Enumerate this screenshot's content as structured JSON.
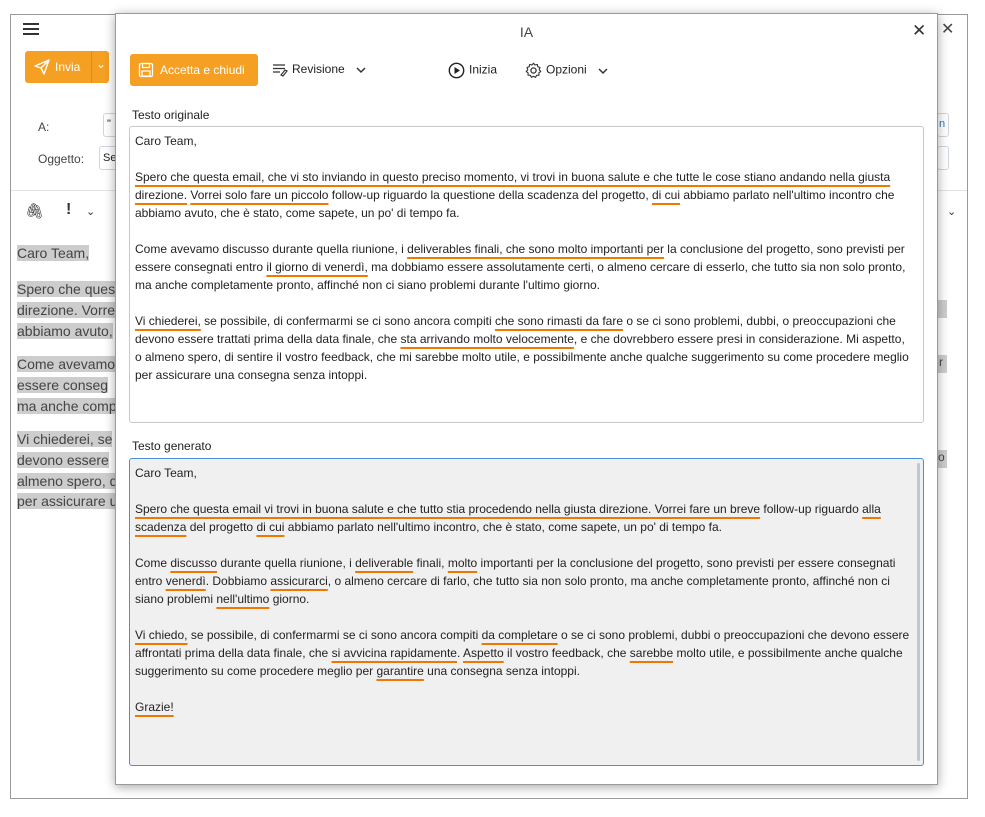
{
  "background": {
    "send_label": "Invia",
    "to_label": "A:",
    "subject_label": "Oggetto:",
    "to_value": "\"",
    "subject_value": "Se",
    "to_right": "n",
    "lines": [
      "Caro Team,",
      "Spero che quest",
      "direzione. Vorre",
      "abbiamo avuto,",
      "Come avevamo",
      "essere conseg",
      "ma anche comp",
      "Vi chiederei, se",
      "devono essere",
      "almeno spero, d",
      "per assicurare u"
    ],
    "right_fragments": [
      "r",
      "o"
    ]
  },
  "dialog": {
    "title": "IA",
    "accept_label": "Accetta e chiudi",
    "revision_label": "Revisione",
    "start_label": "Inizia",
    "options_label": "Opzioni",
    "original_label": "Testo originale",
    "generated_label": "Testo generato"
  },
  "original": {
    "greeting": "Caro Team,",
    "p1": [
      {
        "t": "Spero che questa email, che vi sto inviando in questo preciso momento, vi trovi in buona salute e che tutte le cose stiano andando nella giusta direzione.",
        "u": true
      },
      {
        "t": " ",
        "u": false
      },
      {
        "t": "Vorrei solo fare un piccolo",
        "u": true
      },
      {
        "t": " follow-up riguardo la questione della scadenza del progetto, ",
        "u": false
      },
      {
        "t": "di cui",
        "u": true
      },
      {
        "t": " abbiamo parlato nell'ultimo incontro che abbiamo avuto, che è stato, come sapete, un po' di tempo fa.",
        "u": false
      }
    ],
    "p2": [
      {
        "t": "Come avevamo discusso durante quella riunione, i ",
        "u": false
      },
      {
        "t": "deliverables finali, che sono molto importanti per",
        "u": true
      },
      {
        "t": " la conclusione del progetto, sono previsti per essere consegnati entro ",
        "u": false
      },
      {
        "t": "il giorno di venerdì,",
        "u": true
      },
      {
        "t": " ma dobbiamo essere assolutamente certi, o almeno cercare di esserlo, che tutto sia non solo pronto, ma anche completamente pronto, affinché non ci siano problemi durante l'ultimo giorno.",
        "u": false
      }
    ],
    "p3": [
      {
        "t": "Vi chiederei,",
        "u": true
      },
      {
        "t": " se possibile, di confermarmi se ci sono ancora compiti ",
        "u": false
      },
      {
        "t": "che sono rimasti da fare",
        "u": true
      },
      {
        "t": " o se ci sono problemi, dubbi, o preoccupazioni che devono essere trattati prima della data finale, che ",
        "u": false
      },
      {
        "t": "sta arrivando molto velocemente",
        "u": true
      },
      {
        "t": ", e che dovrebbero essere presi in considerazione. Mi aspetto, o almeno spero, di sentire il vostro feedback, che mi sarebbe molto utile, e possibilmente anche qualche suggerimento su come procedere meglio per assicurare una consegna senza intoppi.",
        "u": false
      }
    ]
  },
  "generated": {
    "greeting": "Caro Team,",
    "p1": [
      {
        "t": "Spero che questa email vi trovi in buona salute e che tutto stia procedendo nella giusta direzione. Vorrei fare un breve",
        "u": true
      },
      {
        "t": " follow-up riguardo ",
        "u": false
      },
      {
        "t": "alla scadenza",
        "u": true
      },
      {
        "t": " del progetto ",
        "u": false
      },
      {
        "t": "di cui",
        "u": true
      },
      {
        "t": " abbiamo parlato nell'ultimo incontro, che è stato, come sapete, un po' di tempo fa.",
        "u": false
      }
    ],
    "p2": [
      {
        "t": "Come ",
        "u": false
      },
      {
        "t": "discusso",
        "u": true
      },
      {
        "t": " durante quella riunione, i ",
        "u": false
      },
      {
        "t": "deliverable",
        "u": true
      },
      {
        "t": " finali, ",
        "u": false
      },
      {
        "t": "molto",
        "u": true
      },
      {
        "t": " importanti per la conclusione del progetto, sono previsti per essere consegnati entro ",
        "u": false
      },
      {
        "t": "venerdì",
        "u": true
      },
      {
        "t": ". Dobbiamo ",
        "u": false
      },
      {
        "t": "assicurarci",
        "u": true
      },
      {
        "t": ", o almeno cercare di farlo, che tutto sia non solo pronto, ma anche completamente pronto, affinché non ci siano problemi ",
        "u": false
      },
      {
        "t": "nell'ultimo",
        "u": true
      },
      {
        "t": " giorno.",
        "u": false
      }
    ],
    "p3": [
      {
        "t": "Vi chiedo,",
        "u": true
      },
      {
        "t": " se possibile, di confermarmi se ci sono ancora compiti ",
        "u": false
      },
      {
        "t": "da completare",
        "u": true
      },
      {
        "t": " o se ci sono problemi, dubbi o preoccupazioni che devono essere affrontati prima della data finale, che ",
        "u": false
      },
      {
        "t": "si avvicina rapidamente",
        "u": true
      },
      {
        "t": ". ",
        "u": false
      },
      {
        "t": "Aspetto",
        "u": true
      },
      {
        "t": " il vostro feedback, che ",
        "u": false
      },
      {
        "t": "sarebbe",
        "u": true
      },
      {
        "t": " molto utile, e possibilmente anche qualche suggerimento su come procedere meglio per ",
        "u": false
      },
      {
        "t": "garantire",
        "u": true
      },
      {
        "t": " una consegna senza intoppi.",
        "u": false
      }
    ],
    "closing": "Grazie!"
  },
  "colors": {
    "accent": "#f5a023",
    "underline": "#f07800",
    "focus_border": "#4a90d9"
  }
}
